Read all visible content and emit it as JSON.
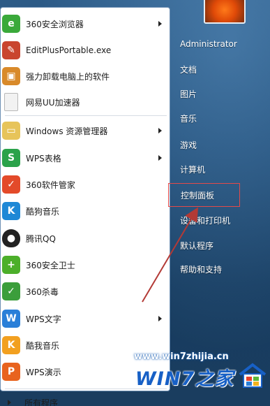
{
  "programs": [
    {
      "label": "360安全浏览器",
      "icon": "360-browser-icon",
      "color": "#3aa93a",
      "has_arrow": true
    },
    {
      "label": "EditPlusPortable.exe",
      "icon": "editplus-icon",
      "color": "#c9452f",
      "has_arrow": false
    },
    {
      "label": "强力卸载电脑上的软件",
      "icon": "uninstall-box-icon",
      "color": "#d98a2a",
      "has_arrow": false
    },
    {
      "label": "网易UU加速器",
      "icon": "blank-document-icon",
      "color": "#f2f2f2",
      "has_arrow": false
    },
    {
      "label": "Windows 资源管理器",
      "icon": "explorer-folder-icon",
      "color": "#e7c45a",
      "has_arrow": true
    },
    {
      "label": "WPS表格",
      "icon": "wps-sheet-icon",
      "color": "#2aa24a",
      "has_arrow": true
    },
    {
      "label": "360软件管家",
      "icon": "360-software-manager-icon",
      "color": "#e34a2a",
      "has_arrow": false
    },
    {
      "label": "酷狗音乐",
      "icon": "kugou-icon",
      "color": "#1e88d6",
      "has_arrow": false
    },
    {
      "label": "腾讯QQ",
      "icon": "qq-penguin-icon",
      "color": "#222222",
      "has_arrow": false
    },
    {
      "label": "360安全卫士",
      "icon": "360-security-guard-icon",
      "color": "#4caf2a",
      "has_arrow": false
    },
    {
      "label": "360杀毒",
      "icon": "360-antivirus-icon",
      "color": "#3b9e3b",
      "has_arrow": false
    },
    {
      "label": "WPS文字",
      "icon": "wps-writer-icon",
      "color": "#2a7fd8",
      "has_arrow": true
    },
    {
      "label": "酷我音乐",
      "icon": "kuwo-icon",
      "color": "#f2a020",
      "has_arrow": false
    },
    {
      "label": "WPS演示",
      "icon": "wps-presentation-icon",
      "color": "#e8631e",
      "has_arrow": false
    }
  ],
  "all_programs_label": "所有程序",
  "right_pane": {
    "user": "Administrator",
    "items": [
      "文档",
      "图片",
      "音乐",
      "游戏",
      "计算机",
      "控制面板",
      "设备和打印机",
      "默认程序",
      "帮助和支持"
    ]
  },
  "watermark": {
    "url": "www.win7zhijia.cn",
    "logo": "WIN7之家"
  },
  "colors": {
    "highlight_border": "#e44a4a",
    "annotation_arrow": "#b33a36"
  }
}
